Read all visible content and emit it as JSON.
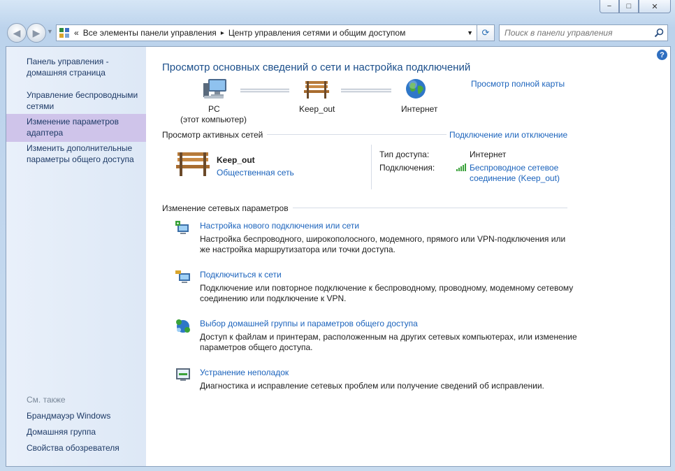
{
  "window": {
    "min": "−",
    "max": "□",
    "close": "✕"
  },
  "address": {
    "chevron": "«",
    "crumb1": "Все элементы панели управления",
    "sep": "▸",
    "crumb2": "Центр управления сетями и общим доступом"
  },
  "search": {
    "placeholder": "Поиск в панели управления"
  },
  "sidebar": {
    "home": "Панель управления - домашняя страница",
    "wireless": "Управление беспроводными сетями",
    "adapter": "Изменение параметров адаптера",
    "sharing": "Изменить дополнительные параметры общего доступа",
    "see_also": "См. также",
    "firewall": "Брандмауэр Windows",
    "homegroup": "Домашняя группа",
    "browser": "Свойства обозревателя"
  },
  "main": {
    "title": "Просмотр основных сведений о сети и настройка подключений",
    "full_map": "Просмотр полной карты",
    "map": {
      "pc": "PC",
      "pc_sub": "(этот компьютер)",
      "network": "Keep_out",
      "internet": "Интернет"
    },
    "active_header": "Просмотр активных сетей",
    "connect_link": "Подключение или отключение",
    "net_name": "Keep_out",
    "net_type": "Общественная сеть",
    "access_label": "Тип доступа:",
    "access_value": "Интернет",
    "connections_label": "Подключения:",
    "connections_value_1": "Беспроводное сетевое",
    "connections_value_2": "соединение (Keep_out)",
    "change_header": "Изменение сетевых параметров",
    "tasks": [
      {
        "title": "Настройка нового подключения или сети",
        "desc": "Настройка беспроводного, широкополосного, модемного, прямого или VPN-подключения или же настройка маршрутизатора или точки доступа."
      },
      {
        "title": "Подключиться к сети",
        "desc": "Подключение или повторное подключение к беспроводному, проводному, модемному сетевому соединению или подключение к VPN."
      },
      {
        "title": "Выбор домашней группы и параметров общего доступа",
        "desc": "Доступ к файлам и принтерам, расположенным на других сетевых компьютерах, или изменение параметров общего доступа."
      },
      {
        "title": "Устранение неполадок",
        "desc": "Диагностика и исправление сетевых проблем или получение сведений об исправлении."
      }
    ]
  }
}
